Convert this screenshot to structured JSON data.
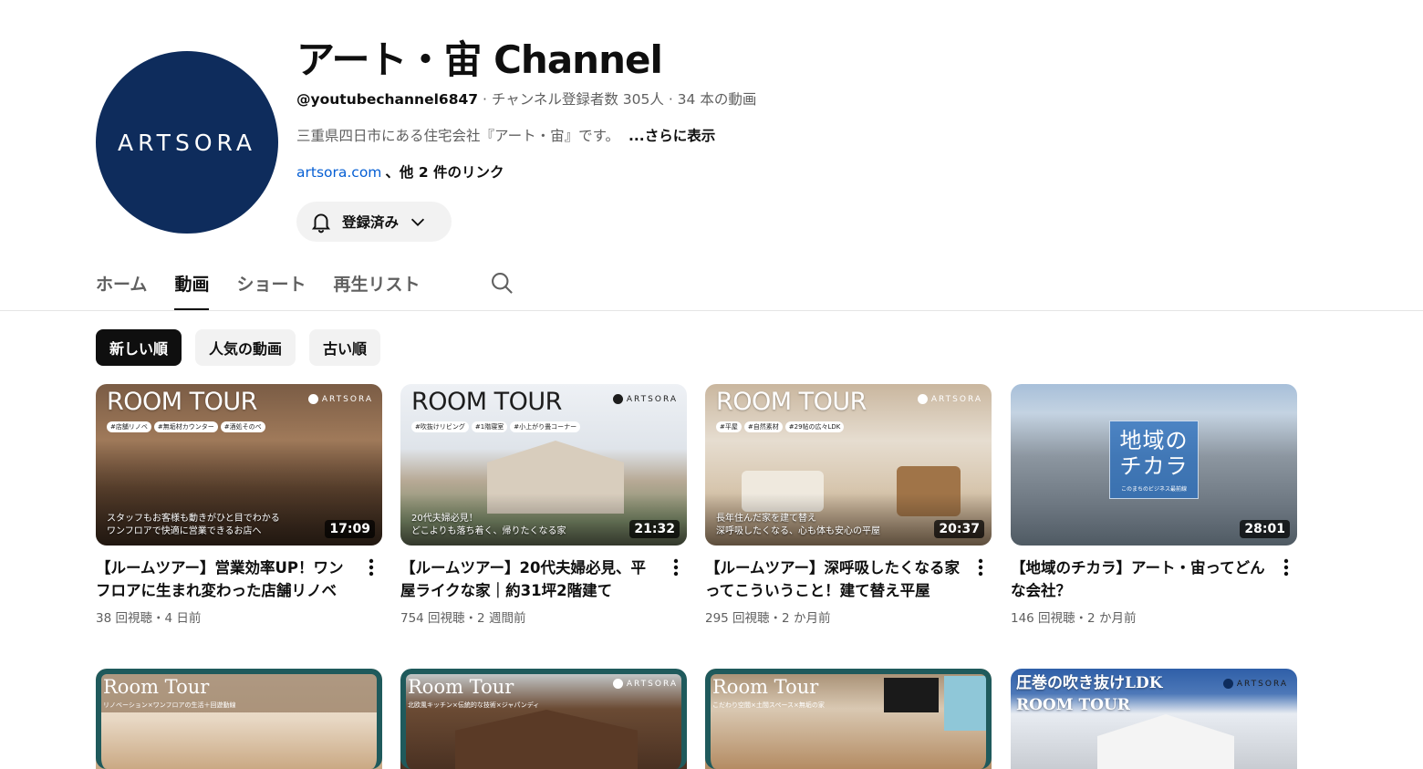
{
  "channel": {
    "avatar_text": "ARTSORA",
    "title": "アート・宙 Channel",
    "handle": "@youtubechannel6847",
    "meta": " · チャンネル登録者数 305人 · 34 本の動画",
    "description": "三重県四日市にある住宅会社『アート・宙』です。",
    "more_label": "...さらに表示",
    "link_text": "artsora.com",
    "links_more": "、他 2 件のリンク",
    "subscribe_label": "登録済み"
  },
  "tabs": [
    {
      "label": "ホーム",
      "active": false
    },
    {
      "label": "動画",
      "active": true
    },
    {
      "label": "ショート",
      "active": false
    },
    {
      "label": "再生リスト",
      "active": false
    }
  ],
  "chips": [
    {
      "label": "新しい順",
      "active": true
    },
    {
      "label": "人気の動画",
      "active": false
    },
    {
      "label": "古い順",
      "active": false
    }
  ],
  "videos": [
    {
      "title": "【ルームツアー】営業効率UP！ワンフロアに生まれ変わった店舗リノベ",
      "meta": "38 回視聴・4 日前",
      "duration": "17:09",
      "thumb_title": "ROOM TOUR",
      "thumb_brand": "ARTSORA",
      "thumb_tags": [
        "#店舗リノベ",
        "#無垢材カウンター",
        "#酒処そのべ"
      ],
      "thumb_caption_1": "スタッフもお客様も動きがひと目でわかる",
      "thumb_caption_2": "ワンフロアで快適に営業できるお店へ"
    },
    {
      "title": "【ルームツアー】20代夫婦必見、平屋ライクな家｜約31坪2階建て",
      "meta": "754 回視聴・2 週間前",
      "duration": "21:32",
      "thumb_title": "ROOM TOUR",
      "thumb_brand": "ARTSORA",
      "thumb_tags": [
        "#吹抜けリビング",
        "#1階寝室",
        "#小上がり畳コーナー"
      ],
      "thumb_caption_1": "20代夫婦必見！",
      "thumb_caption_2": "どこよりも落ち着く、帰りたくなる家"
    },
    {
      "title": "【ルームツアー】深呼吸したくなる家ってこういうこと！建て替え平屋",
      "meta": "295 回視聴・2 か月前",
      "duration": "20:37",
      "thumb_title": "ROOM TOUR",
      "thumb_brand": "ARTSORA",
      "thumb_tags": [
        "#平屋",
        "#自然素材",
        "#29帖の広々LDK"
      ],
      "thumb_caption_1": "長年住んだ家を建て替え",
      "thumb_caption_2": "深呼吸したくなる、心も体も安心の平屋"
    },
    {
      "title": "【地域のチカラ】アート・宙ってどんな会社？",
      "meta": "146 回視聴・2 か月前",
      "duration": "28:01",
      "thumb_big_1": "地域の",
      "thumb_big_2": "チカラ",
      "thumb_small": "このまちのビジネス最前線"
    }
  ],
  "videos_row2": [
    {
      "thumb_title": "Room Tour",
      "thumb_sub": "リノベーション×ワンフロアの生活＋回遊動線"
    },
    {
      "thumb_title": "Room Tour",
      "thumb_sub": "北欧風キッチン×伝統的な技術×ジャパンディ",
      "thumb_brand": "ARTSORA"
    },
    {
      "thumb_title": "Room Tour",
      "thumb_sub": "こだわり空間×土間スペース×無垢の家"
    },
    {
      "thumb_title_1": "圧巻の吹き抜けLDK",
      "thumb_title_2": "ROOM TOUR",
      "thumb_brand": "ARTSORA"
    }
  ],
  "colors": {
    "avatar_bg": "#0e2c5c",
    "link": "#065fd4",
    "chip_active": "#0f0f0f",
    "room_frame": "#1f5a5c"
  },
  "icons": [
    "bell-icon",
    "chevron-down-icon",
    "search-icon",
    "more-vert-icon"
  ]
}
